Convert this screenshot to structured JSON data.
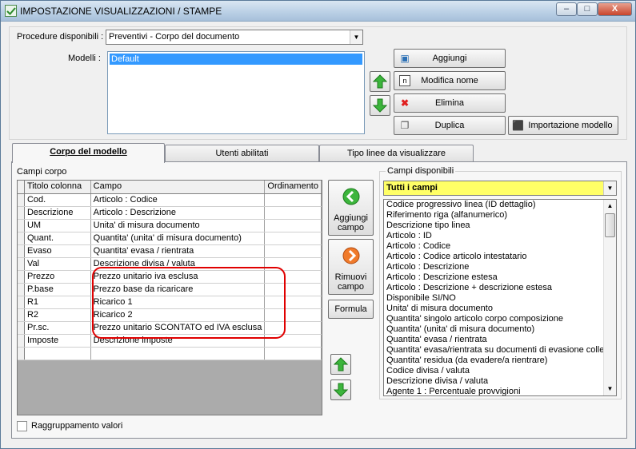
{
  "window": {
    "title": "IMPOSTAZIONE VISUALIZZAZIONI / STAMPE",
    "controls": {
      "minimize": "–",
      "maximize": "□",
      "close": "X"
    }
  },
  "form": {
    "procedure_label": "Procedure disponibili :",
    "procedure_value": "Preventivi - Corpo del documento",
    "modelli_label": "Modelli :",
    "modelli_items": [
      "Default"
    ]
  },
  "buttons": {
    "aggiungi": "Aggiungi",
    "modifica_nome": "Modifica nome",
    "elimina": "Elimina",
    "duplica": "Duplica",
    "importazione": "Importazione modello"
  },
  "tabs": [
    "Corpo del modello",
    "Utenti abilitati",
    "Tipo linee da visualizzare"
  ],
  "campi_corpo": {
    "label": "Campi corpo",
    "headers": [
      "Titolo colonna",
      "Campo",
      "Ordinamento"
    ],
    "rows": [
      {
        "titolo": "Cod.",
        "campo": "Articolo : Codice"
      },
      {
        "titolo": "Descrizione",
        "campo": "Articolo : Descrizione"
      },
      {
        "titolo": "UM",
        "campo": "Unita' di misura documento"
      },
      {
        "titolo": "Quant.",
        "campo": "Quantita' (unita' di misura documento)"
      },
      {
        "titolo": "Evaso",
        "campo": "Quantita' evasa / rientrata"
      },
      {
        "titolo": "Val",
        "campo": "Descrizione divisa / valuta"
      },
      {
        "titolo": "Prezzo",
        "campo": "Prezzo unitario iva esclusa"
      },
      {
        "titolo": "P.base",
        "campo": "Prezzo base da ricaricare"
      },
      {
        "titolo": "R1",
        "campo": "Ricarico 1"
      },
      {
        "titolo": "R2",
        "campo": "Ricarico 2"
      },
      {
        "titolo": "Pr.sc.",
        "campo": "Prezzo unitario SCONTATO ed IVA esclusa"
      },
      {
        "titolo": "Imposte",
        "campo": "Descrizione imposte"
      },
      {
        "titolo": "",
        "campo": ""
      }
    ]
  },
  "side_buttons": {
    "aggiungi_campo_1": "Aggiungi",
    "aggiungi_campo_2": "campo",
    "rimuovi_campo_1": "Rimuovi",
    "rimuovi_campo_2": "campo",
    "formula": "Formula"
  },
  "campi_disponibili": {
    "label": "Campi disponibili",
    "filter": "Tutti i campi",
    "items": [
      "Codice progressivo linea (ID dettaglio)",
      "Riferimento riga (alfanumerico)",
      "Descrizione tipo linea",
      "Articolo : ID",
      "Articolo : Codice",
      "Articolo : Codice articolo intestatario",
      "Articolo : Descrizione",
      "Articolo : Descrizione estesa",
      "Articolo : Descrizione + descrizione estesa",
      "Disponibile SI/NO",
      "Unita' di misura documento",
      "Quantita' singolo articolo corpo composizione",
      "Quantita' (unita' di misura documento)",
      "Quantita' evasa / rientrata",
      "Quantita' evasa/rientrata su documenti di evasione colleg",
      "Quantita' residua (da evadere/a rientrare)",
      "Codice divisa / valuta",
      "Descrizione divisa / valuta",
      "Agente 1 : Percentuale provvigioni"
    ]
  },
  "raggruppamento_label": "Raggruppamento valori",
  "colors": {
    "highlight": "#ff0000",
    "selection": "#3399ff",
    "filter_bg": "#ffff66"
  }
}
